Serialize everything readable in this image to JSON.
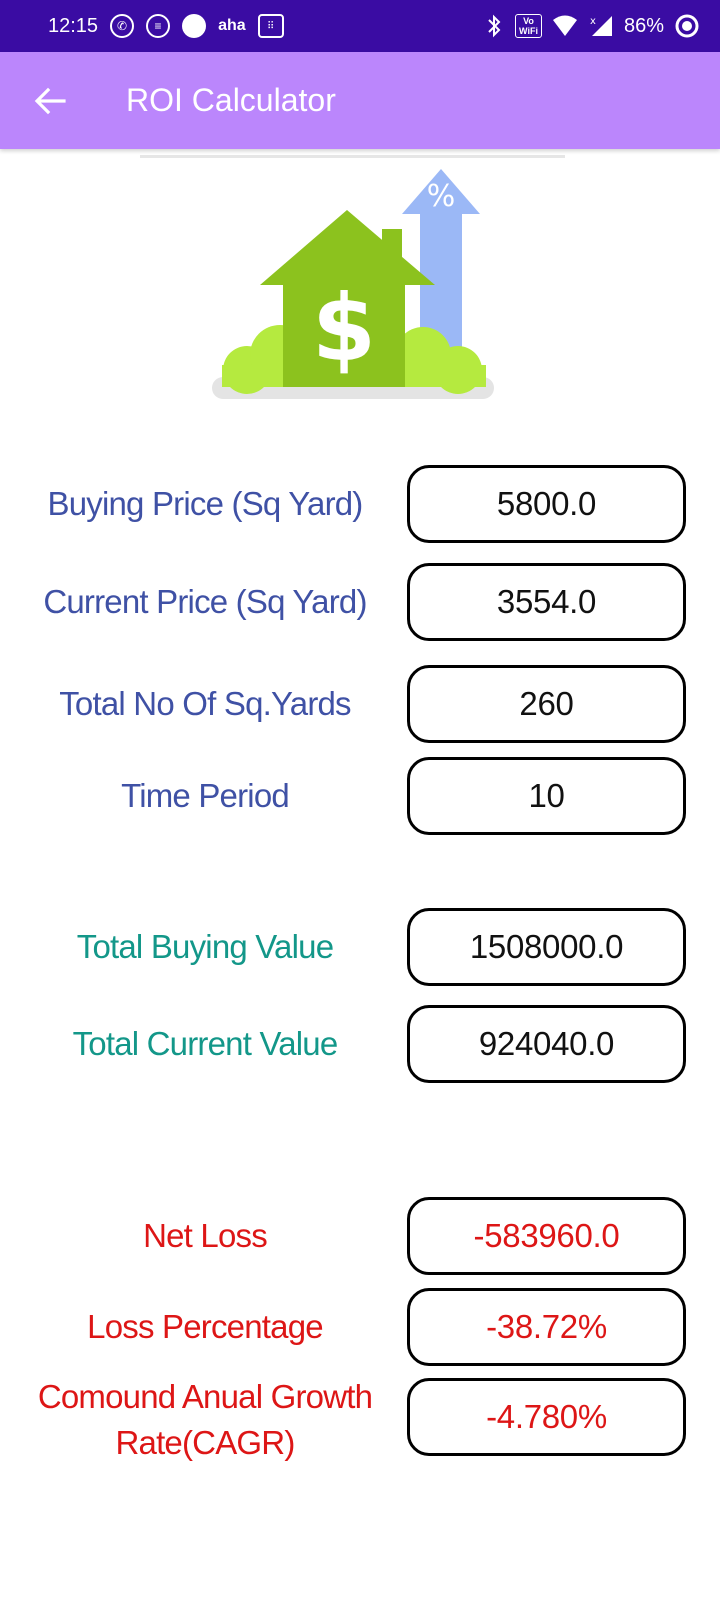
{
  "status_bar": {
    "time": "12:15",
    "aha": "aha",
    "vowifi_top": "Vo",
    "vowifi_bottom": "WiFi",
    "battery": "86%"
  },
  "app_bar": {
    "title": "ROI Calculator",
    "background": "#bb86fc"
  },
  "illustration": {
    "dollar_symbol": "$",
    "percent_symbol": "%"
  },
  "inputs": [
    {
      "label": "Buying Price (Sq Yard)",
      "value": "5800.0"
    },
    {
      "label": "Current Price (Sq Yard)",
      "value": "3554.0"
    },
    {
      "label": "Total No Of Sq.Yards",
      "value": "260"
    },
    {
      "label": "Time Period",
      "value": "10"
    }
  ],
  "totals": [
    {
      "label": "Total Buying Value",
      "value": "1508000.0"
    },
    {
      "label": "Total Current Value",
      "value": "924040.0"
    }
  ],
  "results": [
    {
      "label": "Net Loss",
      "value": "-583960.0"
    },
    {
      "label": "Loss Percentage",
      "value": "-38.72%"
    },
    {
      "label_line1": "Comound Anual Growth",
      "label_line2": "Rate(CAGR)",
      "value": "-4.780%"
    }
  ],
  "colors": {
    "status_bar": "#3a0ca3",
    "input_label": "#3f51a5",
    "total_label": "#139789",
    "result": "#dd1616"
  }
}
